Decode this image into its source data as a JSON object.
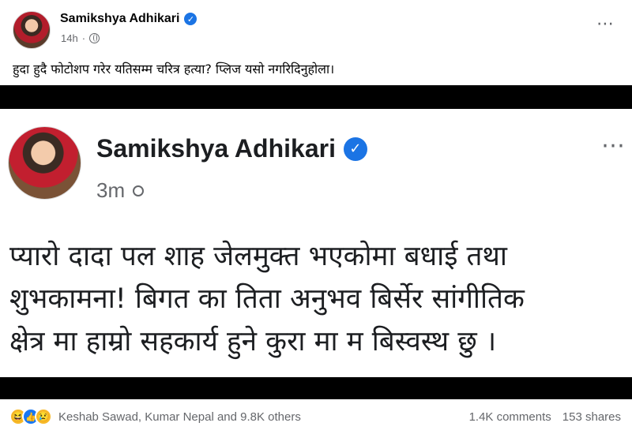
{
  "post": {
    "author": "Samikshya Adhikari",
    "time": "14h",
    "caption": "हुदा हुदै फोटोशप गरेर यतिसम्म चरित्र हत्या? प्लिज यसो नगरिदिनुहोला।",
    "more_glyph": "⋯"
  },
  "embed": {
    "author": "Samikshya Adhikari",
    "time": "3m",
    "more_glyph": "⋯",
    "lines": [
      "प्यारो दादा पल शाह जेलमुक्त भएकोमा बधाई तथा",
      "शुभकामना! बिगत का तिता अनुभव बिर्सेर सांगीतिक",
      "क्षेत्र मा हाम्रो सहकार्य हुने कुरा मा म बिस्वस्थ छु ।"
    ]
  },
  "footer": {
    "reactions": [
      "laugh-emoji-icon",
      "like-icon",
      "sad-emoji-icon"
    ],
    "reactors": "Keshab Sawad, Kumar Nepal and 9.8K others",
    "comments": "1.4K comments",
    "shares": "153 shares"
  },
  "colors": {
    "verified": "#1b74e4",
    "meta": "#65676b",
    "frame": "#000000"
  }
}
